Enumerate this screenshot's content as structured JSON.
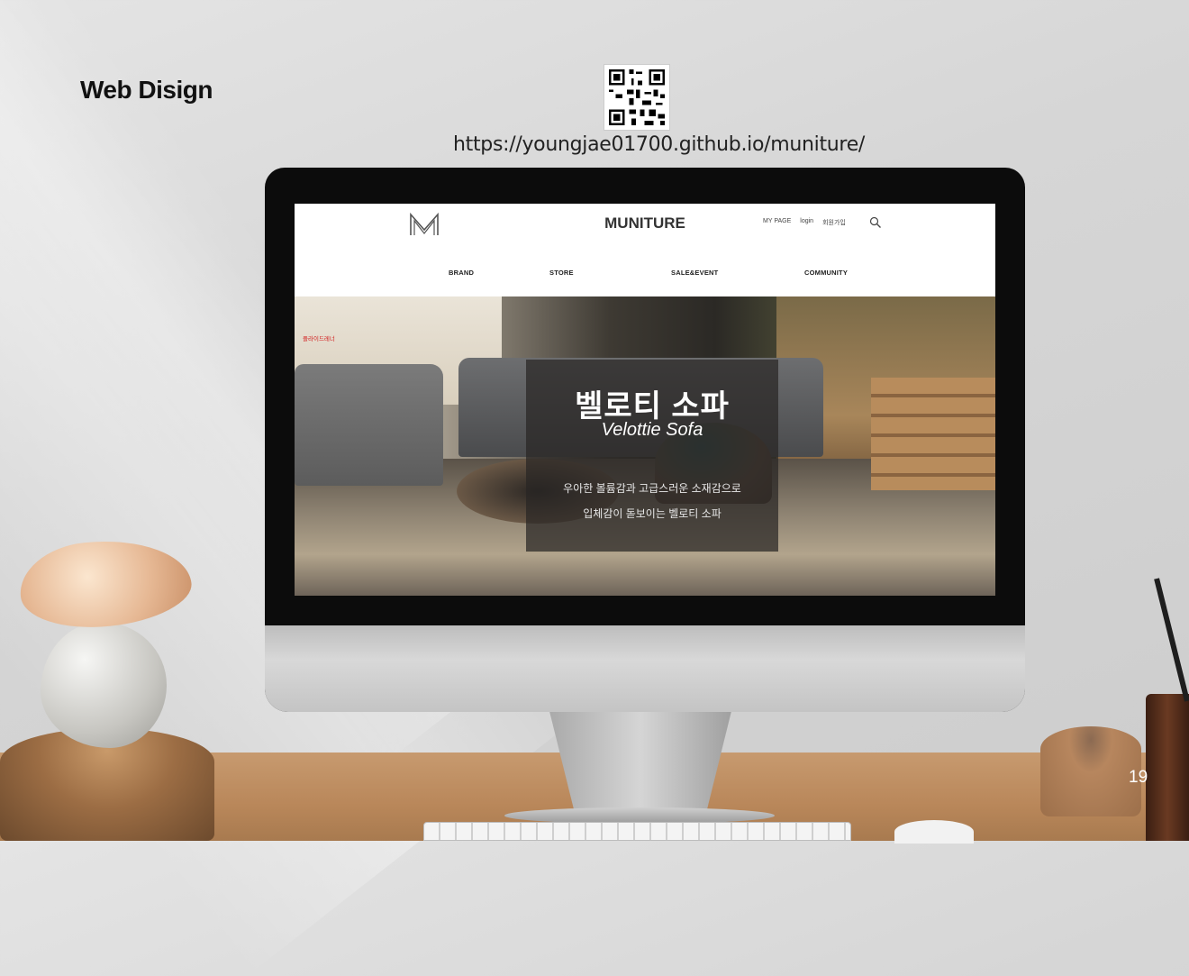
{
  "slide": {
    "title": "Web Disign",
    "url": "https://youngjae01700.github.io/muniture/",
    "page_number": "19"
  },
  "site": {
    "brand": "MUNITURE",
    "utility_links": [
      "MY PAGE",
      "login",
      "회원가입"
    ],
    "nav": [
      "BRAND",
      "STORE",
      "SALE&EVENT",
      "COMMUNITY"
    ],
    "hero": {
      "note": "플라이드레너",
      "title": "벨로티 소파",
      "subtitle": "Velottie Sofa",
      "desc_line1": "우아한 볼륨감과 고급스러운 소재감으로",
      "desc_line2": "입체감이 돋보이는 벨로티 소파"
    }
  },
  "colors": {
    "accent_red": "#d21f1f",
    "overlay": "rgba(40,38,36,0.72)"
  },
  "icons": [
    "qr-code-icon",
    "muniture-logo-icon",
    "search-icon"
  ]
}
